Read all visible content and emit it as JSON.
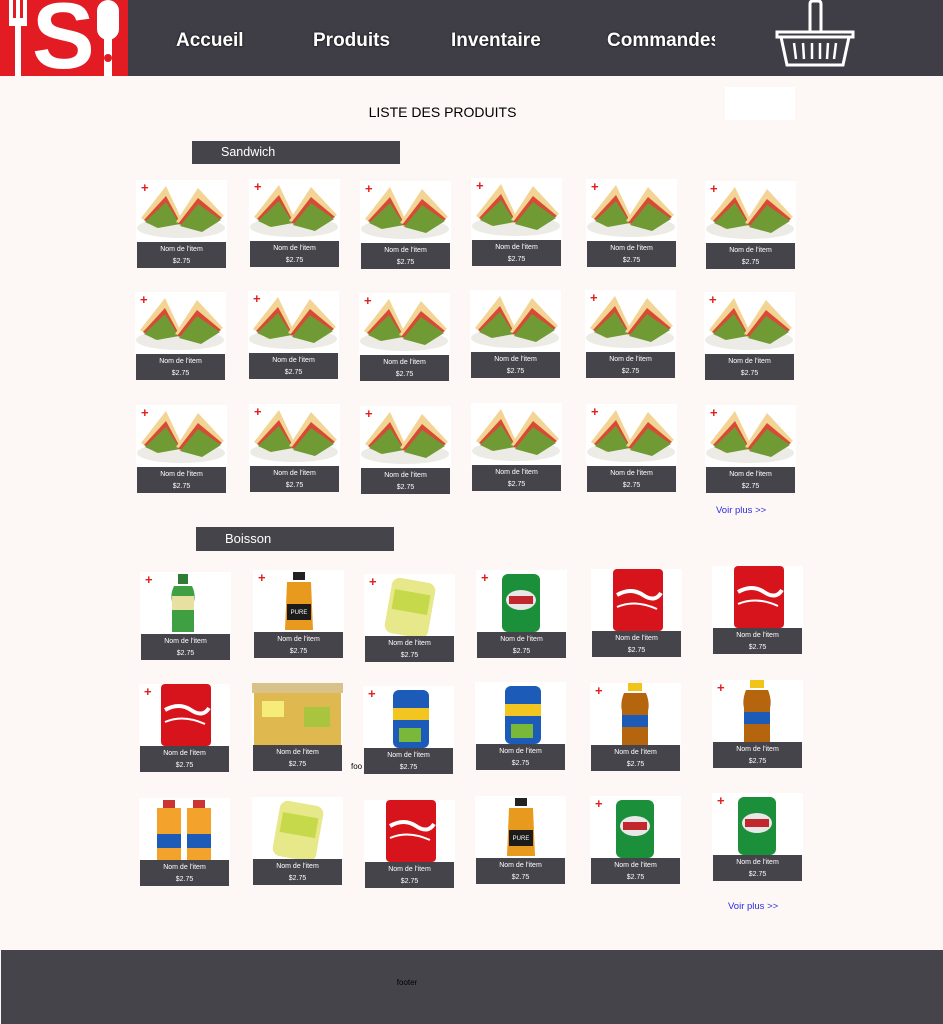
{
  "nav": {
    "links": [
      "Accueil",
      "Produits",
      "Inventaire",
      "Commandes"
    ],
    "logo_letter": "S"
  },
  "page": {
    "title": "LISTE DES PRODUITS"
  },
  "categories": [
    {
      "name": "Sandwich",
      "more": "Voir plus >>"
    },
    {
      "name": "Boisson",
      "more": "Voir plus >>"
    }
  ],
  "item": {
    "name": "Nom de l'item",
    "price": "$2.75",
    "add_symbol": "+"
  },
  "drinks": [
    "green-tea-bottle",
    "pure-leaf-bottle",
    "lime-soda-can",
    "canada-dry-can",
    "coca-cola-can",
    "coca-cola-can",
    "coca-cola-can",
    "iced-tea-glass",
    "nestea-can",
    "nestea-can",
    "iced-tea-bottle",
    "iced-tea-bottle",
    "juice-bottles",
    "lime-soda-can",
    "coca-cola-can",
    "pure-leaf-bottle",
    "canada-dry-can",
    "canada-dry-can"
  ],
  "stray_text": "foo",
  "footer": {
    "text": "footer"
  },
  "colors": {
    "header": "#3f3d45",
    "logo": "#e31b23",
    "caption": "#46444b",
    "link": "#2b2be0",
    "plus": "#e0201c"
  }
}
